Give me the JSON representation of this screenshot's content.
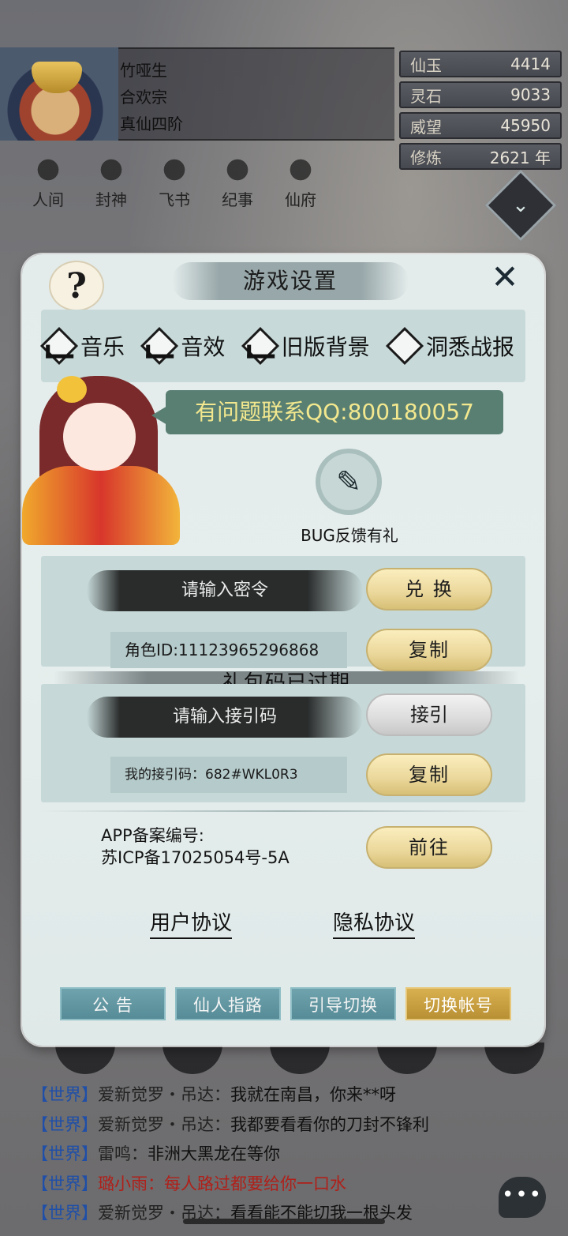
{
  "player": {
    "name": "竹哑生",
    "sect": "合欢宗",
    "realm": "真仙四阶"
  },
  "stats": [
    {
      "label": "仙玉",
      "value": "4414"
    },
    {
      "label": "灵石",
      "value": "9033"
    },
    {
      "label": "威望",
      "value": "45950"
    },
    {
      "label": "修炼",
      "value": "2621 年"
    }
  ],
  "nav": [
    "人间",
    "封神",
    "飞书",
    "纪事",
    "仙府"
  ],
  "modal": {
    "help_icon": "?",
    "title": "游戏设置",
    "close_icon": "✕",
    "toggles": [
      {
        "label": "音乐",
        "checked": true
      },
      {
        "label": "音效",
        "checked": true
      },
      {
        "label": "旧版背景",
        "checked": true
      },
      {
        "label": "洞悉战报",
        "checked": false
      }
    ],
    "contact": "有问题联系QQ:800180057",
    "bug_icon": "✎",
    "bug_label": "BUG反馈有礼",
    "code_placeholder": "请输入密令",
    "redeem_button": "兑 换",
    "role_id": "角色ID:11123965296868",
    "copy_button": "复制",
    "expired_notice": "礼包码已过期",
    "invite_placeholder": "请输入接引码",
    "invite_button": "接引",
    "my_invite": "我的接引码：682#WKL0R3",
    "copy_button_2": "复制",
    "icp_label": "APP备案编号:",
    "icp_number": "苏ICP备17025054号-5A",
    "goto_button": "前往",
    "user_agreement": "用户协议",
    "privacy_agreement": "隐私协议",
    "bottom_buttons": [
      "公 告",
      "仙人指路",
      "引导切换",
      "切换帐号"
    ]
  },
  "chat": [
    {
      "channel": "【世界】",
      "name": "爱新觉罗・吊达：",
      "msg": "我就在南昌，你来**呀",
      "highlight": false
    },
    {
      "channel": "【世界】",
      "name": "爱新觉罗・吊达：",
      "msg": "我都要看看你的刀封不锋利",
      "highlight": false
    },
    {
      "channel": "【世界】",
      "name": "雷鸣：",
      "msg": "非洲大黑龙在等你",
      "highlight": false
    },
    {
      "channel": "【世界】",
      "name": "璐小雨：",
      "msg": "每人路过都要给你一口水",
      "highlight": true
    },
    {
      "channel": "【世界】",
      "name": "爱新觉罗・吊达：",
      "msg": "看看能不能切我一根头发",
      "highlight": false
    }
  ],
  "chat_button": "•••"
}
